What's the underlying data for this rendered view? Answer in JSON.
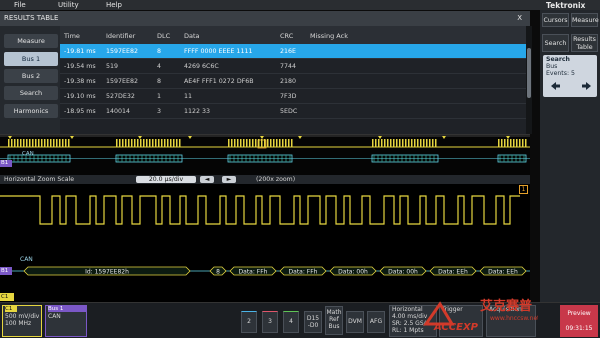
{
  "menu": {
    "file": "File",
    "utility": "Utility",
    "help": "Help"
  },
  "brand": "Tektronix",
  "results": {
    "title": "RESULTS TABLE",
    "close": "X",
    "tabs": [
      "Measure",
      "Bus 1",
      "Bus 2",
      "Search",
      "Harmonics"
    ],
    "selected_tab": 1,
    "columns": [
      "Time",
      "Identifier",
      "DLC",
      "Data",
      "CRC",
      "Missing Ack"
    ],
    "rows": [
      [
        "-19.81 ms",
        "1597EE82",
        "8",
        "FFFF 0000 EEEE 1111",
        "216E",
        ""
      ],
      [
        "-19.54 ms",
        "519",
        "4",
        "4269 6C6C",
        "7744",
        ""
      ],
      [
        "-19.38 ms",
        "1597EE82",
        "8",
        "AE4F FFF1 0272 DF6B",
        "2180",
        ""
      ],
      [
        "-19.10 ms",
        "527DE32",
        "1",
        "11",
        "7F3D",
        ""
      ],
      [
        "-18.95 ms",
        "140014",
        "3",
        "1122 33",
        "5EDC",
        ""
      ]
    ],
    "selected_row": 0
  },
  "side": {
    "cursors": "Cursors",
    "measure": "Measure",
    "search": "Search",
    "results_table": "Results Table",
    "badge_title": "Search",
    "badge_line1": "Bus",
    "badge_line2": "Events: 5"
  },
  "overview": {
    "bus_label": "B1",
    "can_label": "CAN",
    "c1_label": "C1"
  },
  "zoom": {
    "label": "Horizontal Zoom Scale",
    "value": "20.0 µs/div",
    "zoom": "(200x zoom)"
  },
  "wave": {
    "bus_label": "B1",
    "can_label": "CAN",
    "id_packet": "Id: 1597EE82h",
    "dlc": "8",
    "data_packets": [
      "Data: FFh",
      "Data: FFh",
      "Data: 00h",
      "Data: 00h",
      "Data: EEh",
      "Data: EEh"
    ],
    "c1_label": "C1",
    "ch_marker": "1"
  },
  "footer": {
    "ch1": "C1",
    "ch1_scale": "500 mV/div",
    "ch1_bw": "100 MHz",
    "bus1": "Bus 1",
    "bus1_type": "CAN",
    "btn2": "2",
    "btn3": "3",
    "btn4": "4",
    "d15": "D15 -D0",
    "math": "Math Ref Bus",
    "dvm": "DVM",
    "afg": "AFG",
    "horiz": "Horizontal",
    "horiz_val": "4.00 ms/div",
    "sr": "SR: 2.5 GS/s",
    "rl": "RL: 1 Mpts",
    "trigger": "Trigger",
    "acq": "Acquisition",
    "preview": "Preview",
    "time": "09:31:15"
  },
  "watermark": {
    "logo": "ACCEXP",
    "cn": "艾克赛普",
    "url": "www.hnccsw.net"
  },
  "colors": {
    "accent": "#27a7ea",
    "ch1": "#e6d640",
    "bus": "#61d6e8",
    "bus_text": "#9cd4e8"
  }
}
